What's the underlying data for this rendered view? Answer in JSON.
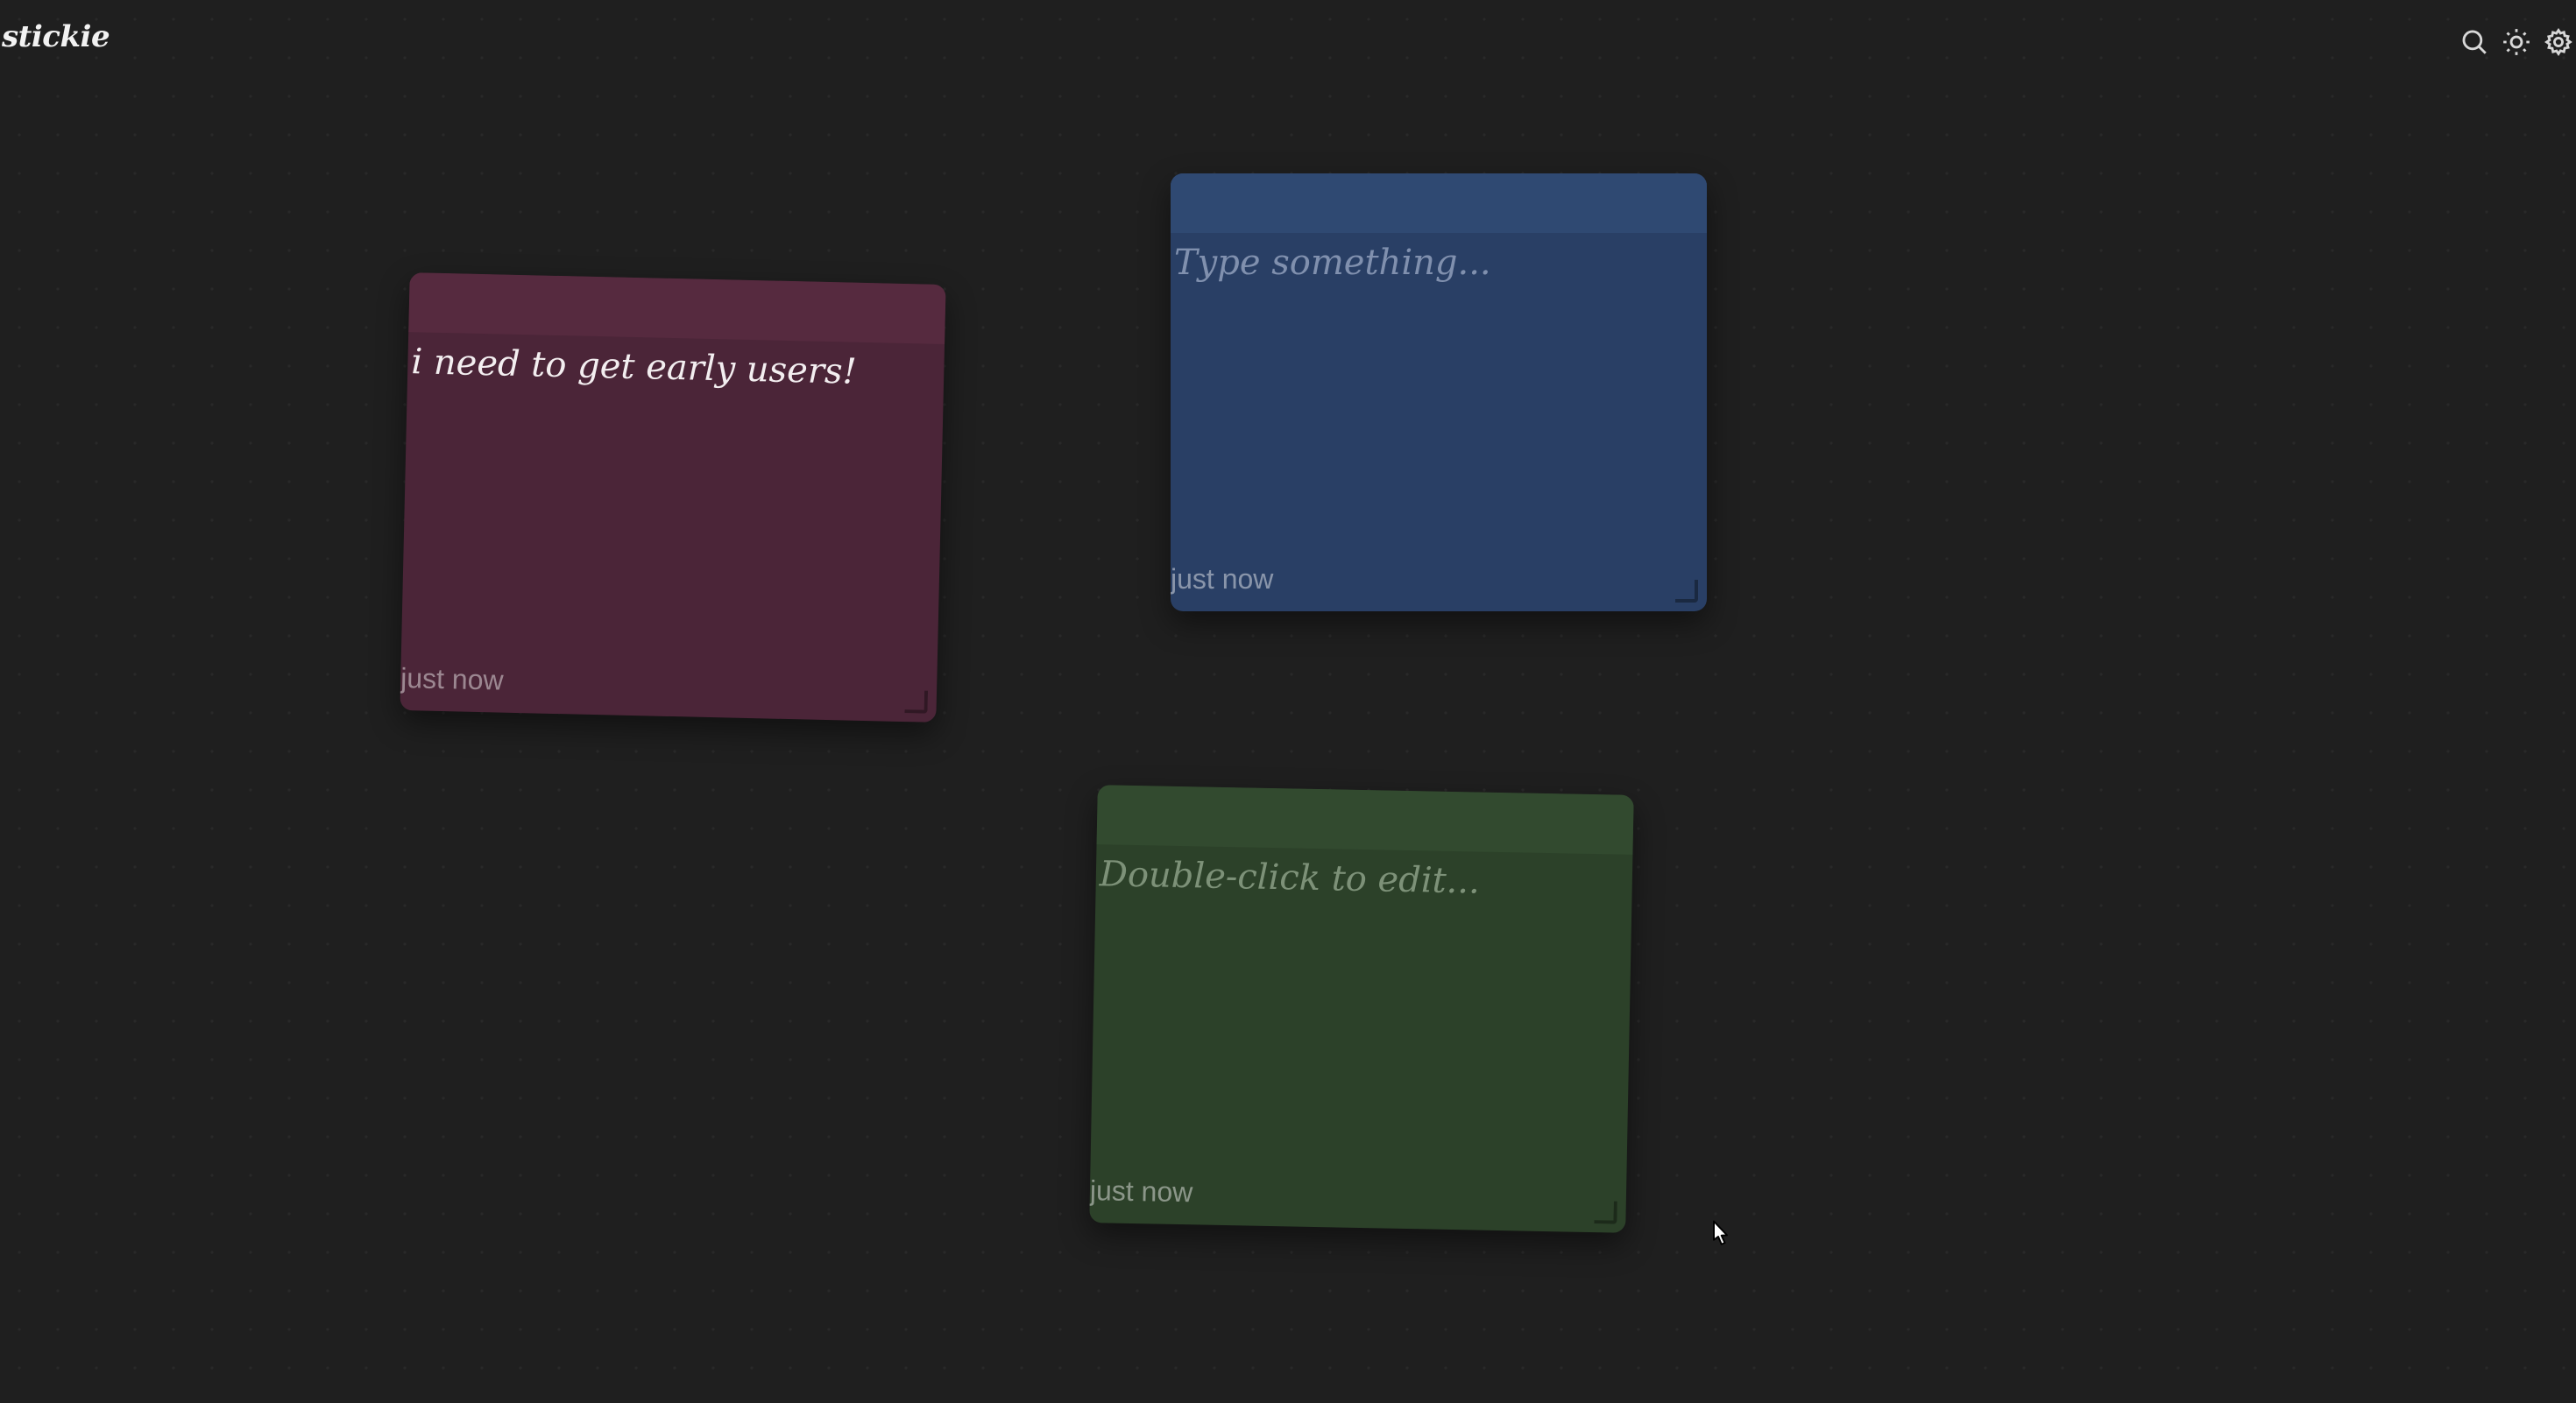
{
  "app": {
    "logo": "stickie"
  },
  "toolbar": {
    "search": {
      "icon": "search-icon"
    },
    "theme": {
      "icon": "sun-icon"
    },
    "settings": {
      "icon": "gear-icon"
    }
  },
  "notes": [
    {
      "color": "#4b2538",
      "text": "i need to get early users!",
      "timestamp": "just now"
    },
    {
      "color": "#293f65",
      "placeholder": "Type something...",
      "timestamp": "just now"
    },
    {
      "color": "#2c4129",
      "placeholder": "Double-click to edit...",
      "timestamp": "just now"
    }
  ],
  "colors": {
    "background": "#1f1f1f"
  }
}
